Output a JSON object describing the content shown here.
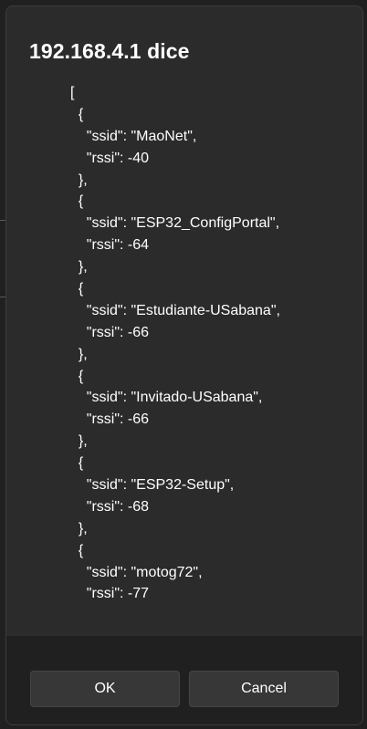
{
  "dialog": {
    "title": "192.168.4.1 dice",
    "message_lines": [
      "[",
      "  {",
      "    \"ssid\": \"MaoNet\",",
      "    \"rssi\": -40",
      "  },",
      "  {",
      "    \"ssid\": \"ESP32_ConfigPortal\",",
      "    \"rssi\": -64",
      "  },",
      "  {",
      "    \"ssid\": \"Estudiante-USabana\",",
      "    \"rssi\": -66",
      "  },",
      "  {",
      "    \"ssid\": \"Invitado-USabana\",",
      "    \"rssi\": -66",
      "  },",
      "  {",
      "    \"ssid\": \"ESP32-Setup\",",
      "    \"rssi\": -68",
      "  },",
      "  {",
      "    \"ssid\": \"motog72\",",
      "    \"rssi\": -77",
      "..."
    ],
    "ok_label": "OK",
    "cancel_label": "Cancel"
  },
  "colors": {
    "dialog_bg": "#2b2b2b",
    "footer_bg": "#202020",
    "button_bg": "#373737",
    "text": "#ffffff"
  }
}
